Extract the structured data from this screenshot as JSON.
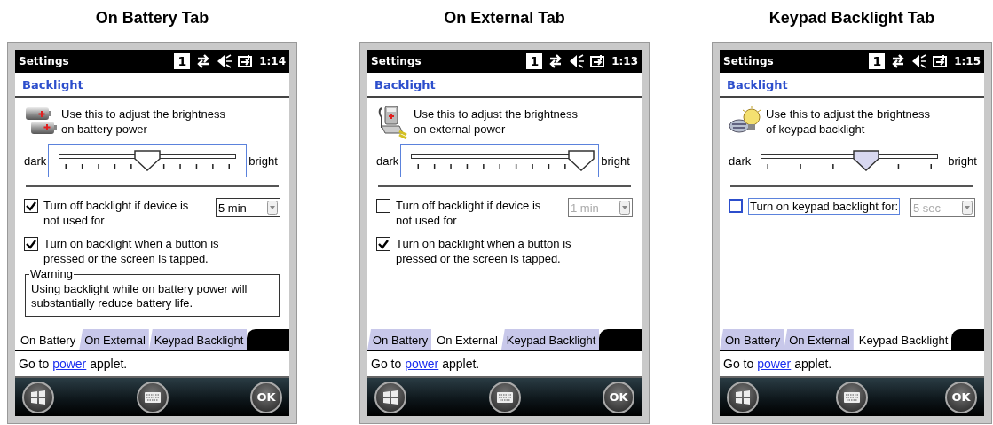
{
  "panels": [
    {
      "caption": "On Battery Tab",
      "kind": "battery",
      "title": "Settings",
      "badge": "1",
      "time": "1:14",
      "heading": "Backlight",
      "intro": "Use this to adjust the brightness on battery power",
      "slider": {
        "start": "dark",
        "end": "bright",
        "level": 0.5,
        "focused": true,
        "kind": "fine"
      },
      "options": [
        {
          "label": "Turn off backlight if device is not used for",
          "checked": true,
          "focused": false,
          "dropdown": {
            "value": "5 min",
            "disabled": false
          }
        },
        {
          "label": "Turn on backlight when a button is pressed or the screen is tapped.",
          "checked": true,
          "focused": false
        }
      ],
      "warning": {
        "legend": "Warning",
        "text": "Using backlight while on battery power will substantially reduce battery life."
      },
      "tabs": [
        {
          "label": "On Battery",
          "selected": true
        },
        {
          "label": "On External",
          "selected": false
        },
        {
          "label": "Keypad Backlight",
          "selected": false
        }
      ],
      "footer": {
        "before": "Go to",
        "link": "power",
        "after": "applet."
      },
      "ok": "OK"
    },
    {
      "caption": "On External Tab",
      "kind": "external",
      "title": "Settings",
      "badge": "1",
      "time": "1:13",
      "heading": "Backlight",
      "intro": "Use this to adjust the brightness on external power",
      "slider": {
        "start": "dark",
        "end": "bright",
        "level": 1,
        "focused": true,
        "kind": "fine"
      },
      "options": [
        {
          "label": "Turn off backlight if device is not used for",
          "checked": false,
          "focused": false,
          "dropdown": {
            "value": "1 min",
            "disabled": true
          }
        },
        {
          "label": "Turn on backlight when a button is pressed or the screen is tapped.",
          "checked": true,
          "focused": false
        }
      ],
      "tabs": [
        {
          "label": "On Battery",
          "selected": false
        },
        {
          "label": "On External",
          "selected": true
        },
        {
          "label": "Keypad Backlight",
          "selected": false
        }
      ],
      "footer": {
        "before": "Go to",
        "link": "power",
        "after": "applet."
      },
      "ok": "OK"
    },
    {
      "caption": "Keypad Backlight Tab",
      "kind": "keypad",
      "title": "Settings",
      "badge": "1",
      "time": "1:15",
      "heading": "Backlight",
      "intro": "Use this to adjust the brightness of keypad backlight",
      "slider": {
        "start": "dark",
        "end": "bright",
        "level": 0.6,
        "focused": false,
        "kind": "coarse"
      },
      "options": [
        {
          "label": "Turn on keypad backlight for:",
          "checked": false,
          "focused": true,
          "dropdown": {
            "value": "5 sec",
            "disabled": true
          }
        }
      ],
      "tabs": [
        {
          "label": "On Battery",
          "selected": false
        },
        {
          "label": "On External",
          "selected": false
        },
        {
          "label": "Keypad Backlight",
          "selected": true
        }
      ],
      "footer": {
        "before": "Go to",
        "link": "power",
        "after": "applet."
      },
      "ok": "OK"
    }
  ]
}
